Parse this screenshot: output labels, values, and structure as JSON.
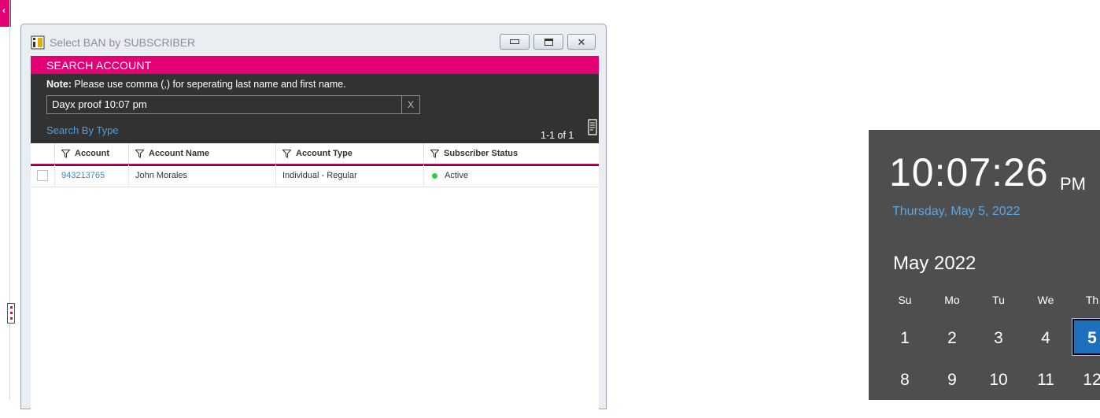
{
  "dialog": {
    "title": "Select BAN by SUBSCRIBER",
    "header_title": "SEARCH ACCOUNT",
    "note_label": "Note:",
    "note_text": " Please use comma (,) for seperating last name and first name.",
    "search_value": "Dayx proof 10:07 pm",
    "clear_label": "X",
    "search_by_type": "Search By Type",
    "pagination": "1-1 of 1",
    "columns": [
      "Account",
      "Account Name",
      "Account Type",
      "Subscriber Status"
    ],
    "rows": [
      {
        "account": "943213765",
        "account_name": "John Morales",
        "account_type": "Individual - Regular",
        "status": "Active"
      }
    ]
  },
  "clock": {
    "time": "10:07:26",
    "ampm": "PM",
    "date": "Thursday, May 5, 2022",
    "month": "May 2022",
    "weekdays": [
      "Su",
      "Mo",
      "Tu",
      "We",
      "Th"
    ],
    "week1": [
      "1",
      "2",
      "3",
      "4",
      "5"
    ],
    "week2": [
      "8",
      "9",
      "10",
      "11",
      "12"
    ]
  },
  "colors": {
    "brand_magenta": "#e20074",
    "panel_dark": "#323232",
    "link_blue": "#2a8ccf",
    "status_active": "#2ecc40",
    "clock_bg": "#4e4e4e",
    "today_highlight": "#1f6fbf"
  }
}
